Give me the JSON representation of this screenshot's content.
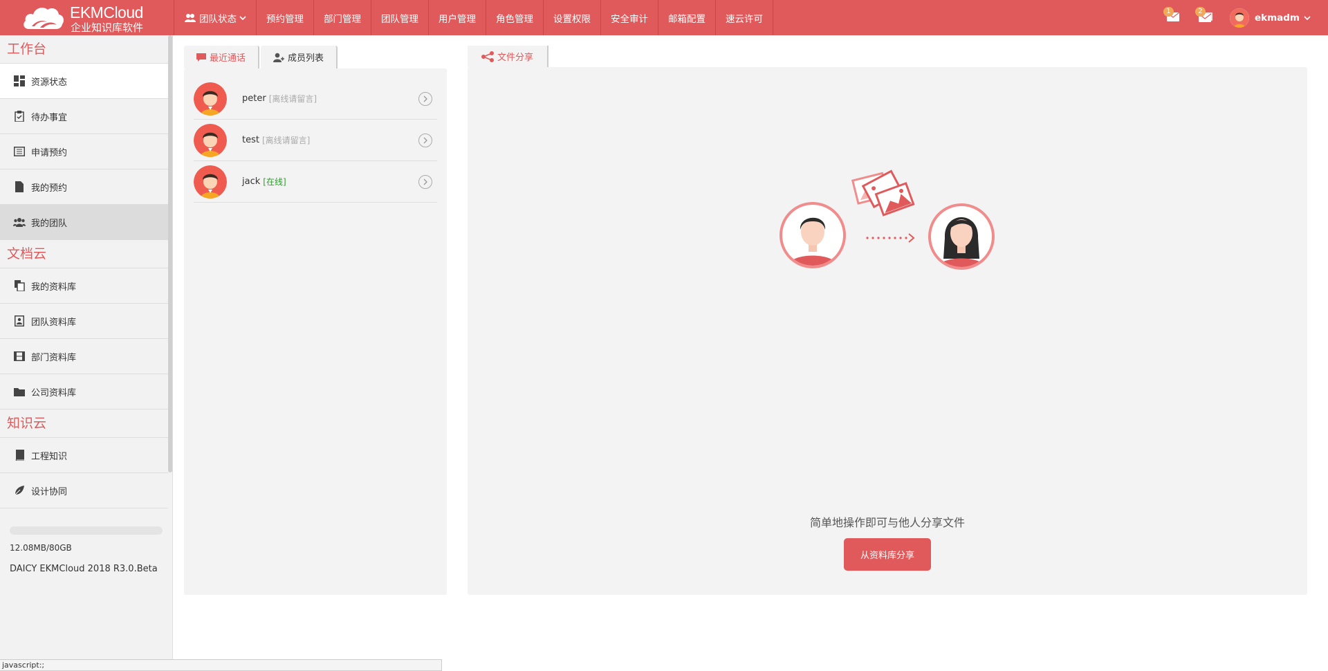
{
  "app": {
    "brand": "EKMCloud",
    "subtitle": "企业知识库软件"
  },
  "nav": {
    "items": [
      {
        "label": "团队状态",
        "has_dropdown": true,
        "icon": "users-icon"
      },
      {
        "label": "预约管理"
      },
      {
        "label": "部门管理"
      },
      {
        "label": "团队管理"
      },
      {
        "label": "用户管理"
      },
      {
        "label": "角色管理"
      },
      {
        "label": "设置权限"
      },
      {
        "label": "安全审计"
      },
      {
        "label": "邮箱配置"
      },
      {
        "label": "速云许可"
      }
    ]
  },
  "header": {
    "messages_count": "1",
    "notices_count": "2",
    "username": "ekmadm"
  },
  "sidebar": {
    "sections": [
      {
        "title": "工作台",
        "items": [
          {
            "label": "资源状态",
            "icon": "dashboard-icon",
            "active": true
          },
          {
            "label": "待办事宜",
            "icon": "clipboard-icon"
          },
          {
            "label": "申请预约",
            "icon": "calendar-list-icon"
          },
          {
            "label": "我的预约",
            "icon": "file-icon"
          },
          {
            "label": "我的团队",
            "icon": "team-icon",
            "hover": true
          }
        ]
      },
      {
        "title": "文档云",
        "items": [
          {
            "label": "我的资料库",
            "icon": "files-icon"
          },
          {
            "label": "团队资料库",
            "icon": "contact-book-icon"
          },
          {
            "label": "部门资料库",
            "icon": "film-icon"
          },
          {
            "label": "公司资料库",
            "icon": "folder-icon"
          }
        ]
      },
      {
        "title": "知识云",
        "items": [
          {
            "label": "工程知识",
            "icon": "book-icon"
          },
          {
            "label": "设计协同",
            "icon": "leaf-icon"
          }
        ]
      }
    ],
    "storage": {
      "used_text": "12.08MB/80GB",
      "used_fraction": 0.0002
    },
    "version": "DAICY EKMCloud 2018 R3.0.Beta"
  },
  "contacts_panel": {
    "tabs": [
      {
        "label": "最近通话",
        "icon": "chat-icon",
        "active": true
      },
      {
        "label": "成员列表",
        "icon": "add-user-icon"
      }
    ],
    "contacts": [
      {
        "name": "peter",
        "status": "[离线请留言]",
        "online": false
      },
      {
        "name": "test",
        "status": "[离线请留言]",
        "online": false
      },
      {
        "name": "jack",
        "status": "[在线]",
        "online": true
      }
    ]
  },
  "share_panel": {
    "tab_label": "文件分享",
    "description": "简单地操作即可与他人分享文件",
    "button_label": "从资料库分享"
  },
  "statusbar": {
    "text": "javascript:;"
  },
  "colors": {
    "accent": "#e05a5c",
    "online": "#2a9d2a",
    "offline": "#aaaaaa"
  }
}
